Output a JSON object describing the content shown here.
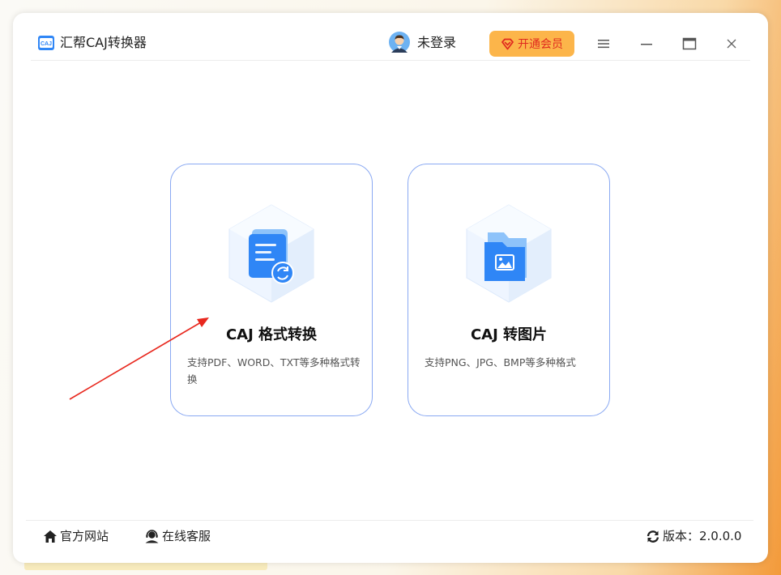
{
  "window": {
    "app_title": "汇帮CAJ转换器",
    "app_icon": "caj-app-icon"
  },
  "header": {
    "login_label": "未登录",
    "vip_label": "开通会员",
    "menu_icon": "menu-icon",
    "minimize_icon": "minimize-icon",
    "maximize_icon": "maximize-icon",
    "close_icon": "close-icon"
  },
  "cards": [
    {
      "title": "CAJ 格式转换",
      "desc": "支持PDF、WORD、TXT等多种格式转换",
      "icon": "document-convert-icon"
    },
    {
      "title": "CAJ 转图片",
      "desc": "支持PNG、JPG、BMP等多种格式",
      "icon": "image-folder-icon"
    }
  ],
  "footer": {
    "website_label": "官方网站",
    "service_label": "在线客服",
    "version_label": "版本：2.0.0.0"
  },
  "colors": {
    "accent_blue": "#2f86f6",
    "vip_bg": "#fcb54a",
    "vip_text": "#e02a1f",
    "card_border": "#8aa9f2",
    "annotation_arrow": "#e8281e"
  }
}
